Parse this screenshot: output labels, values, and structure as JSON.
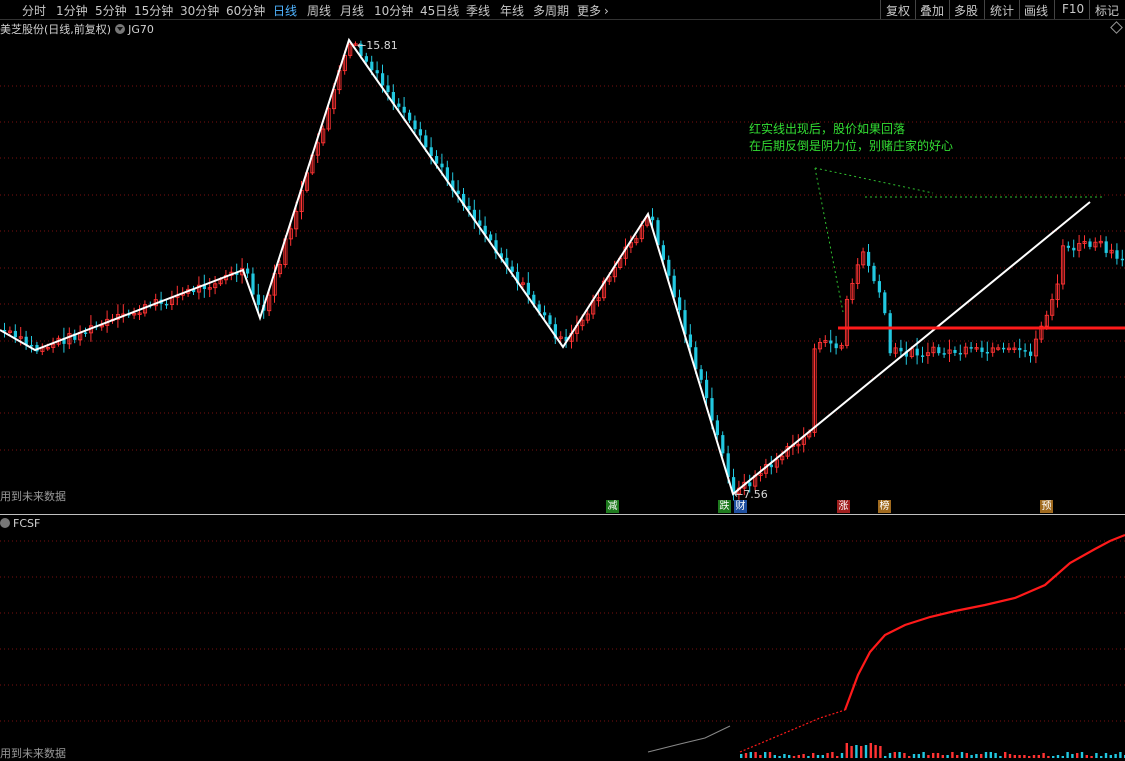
{
  "toolbar": {
    "tabs": [
      "分时",
      "1分钟",
      "5分钟",
      "15分钟",
      "30分钟",
      "60分钟",
      "日线",
      "周线",
      "月线",
      "10分钟",
      "45日线",
      "季线",
      "年线",
      "多周期",
      "更多"
    ],
    "active_tab": "日线",
    "more_arrow": "›",
    "right_tabs": [
      "复权",
      "叠加",
      "多股",
      "统计",
      "画线",
      "F10",
      "标记"
    ]
  },
  "main_panel": {
    "title": "美芝股份(日线,前复权)",
    "indicator": "JG70",
    "high_label": "15.81",
    "low_label": "7.56",
    "future_note": "用到未来数据",
    "annotation_line1": "红实线出现后，股价如果回落",
    "annotation_line2": "在后期反倒是阴力位，别赌庄家的好心",
    "signals": [
      {
        "text": "减",
        "color": "#1e7a1e"
      },
      {
        "text": "跌",
        "color": "#1e7a1e"
      },
      {
        "text": "财",
        "color": "#2050a0"
      },
      {
        "text": "涨",
        "color": "#a01e1e"
      },
      {
        "text": "榜",
        "color": "#a06a1e"
      },
      {
        "text": "预",
        "color": "#a06a1e"
      }
    ]
  },
  "sub_panel": {
    "title": "FCSF",
    "future_note": "用到未来数据"
  },
  "colors": {
    "up": "#ff3333",
    "down": "#22c8e0",
    "grid": "#7a1010",
    "zigzag": "#ffffff",
    "resistance": "#ff1a1a",
    "annotation": "#33dd33",
    "fcsf": "#ff1a1a"
  }
}
